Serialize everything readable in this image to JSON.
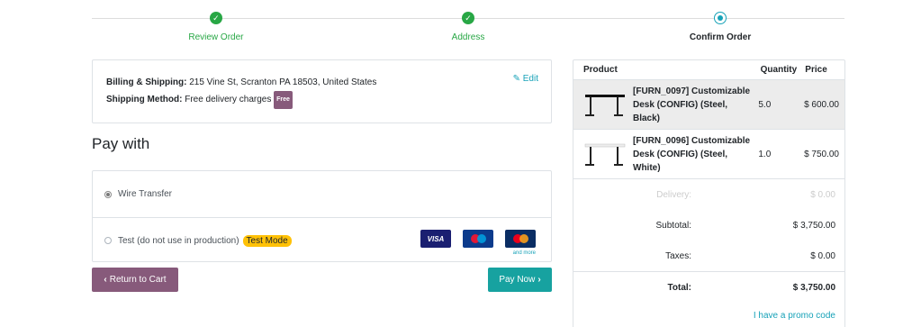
{
  "steps": [
    {
      "label": "Review Order",
      "state": "done"
    },
    {
      "label": "Address",
      "state": "done"
    },
    {
      "label": "Confirm Order",
      "state": "current"
    }
  ],
  "billing": {
    "billing_label": "Billing & Shipping:",
    "billing_value": "215 Vine St, Scranton PA 18503, United States",
    "method_label": "Shipping Method:",
    "method_value": "Free delivery charges",
    "free_badge": "Free",
    "edit_label": "Edit"
  },
  "pay_with_title": "Pay with",
  "payment_options": [
    {
      "label": "Wire Transfer",
      "selected": true
    },
    {
      "label": "Test (do not use in production)",
      "badge": "Test Mode",
      "selected": false
    }
  ],
  "cards": {
    "visa": "VISA",
    "and_more": "and more"
  },
  "buttons": {
    "return": "Return to Cart",
    "pay": "Pay Now"
  },
  "summary": {
    "headers": {
      "product": "Product",
      "quantity": "Quantity",
      "price": "Price"
    },
    "items": [
      {
        "name": "[FURN_0097] Customizable Desk (CONFIG) (Steel, Black)",
        "qty": "5.0",
        "price": "$ 600.00"
      },
      {
        "name": "[FURN_0096] Customizable Desk (CONFIG) (Steel, White)",
        "qty": "1.0",
        "price": "$ 750.00"
      }
    ],
    "delivery_label": "Delivery:",
    "delivery_value": "$ 0.00",
    "subtotal_label": "Subtotal:",
    "subtotal_value": "$ 3,750.00",
    "taxes_label": "Taxes:",
    "taxes_value": "$ 0.00",
    "total_label": "Total:",
    "total_value": "$ 3,750.00",
    "promo": "I have a promo code"
  },
  "colors": {
    "success": "#28a745",
    "accent": "#17a2b8",
    "brand": "#875a7b",
    "warning": "#ffc107"
  }
}
